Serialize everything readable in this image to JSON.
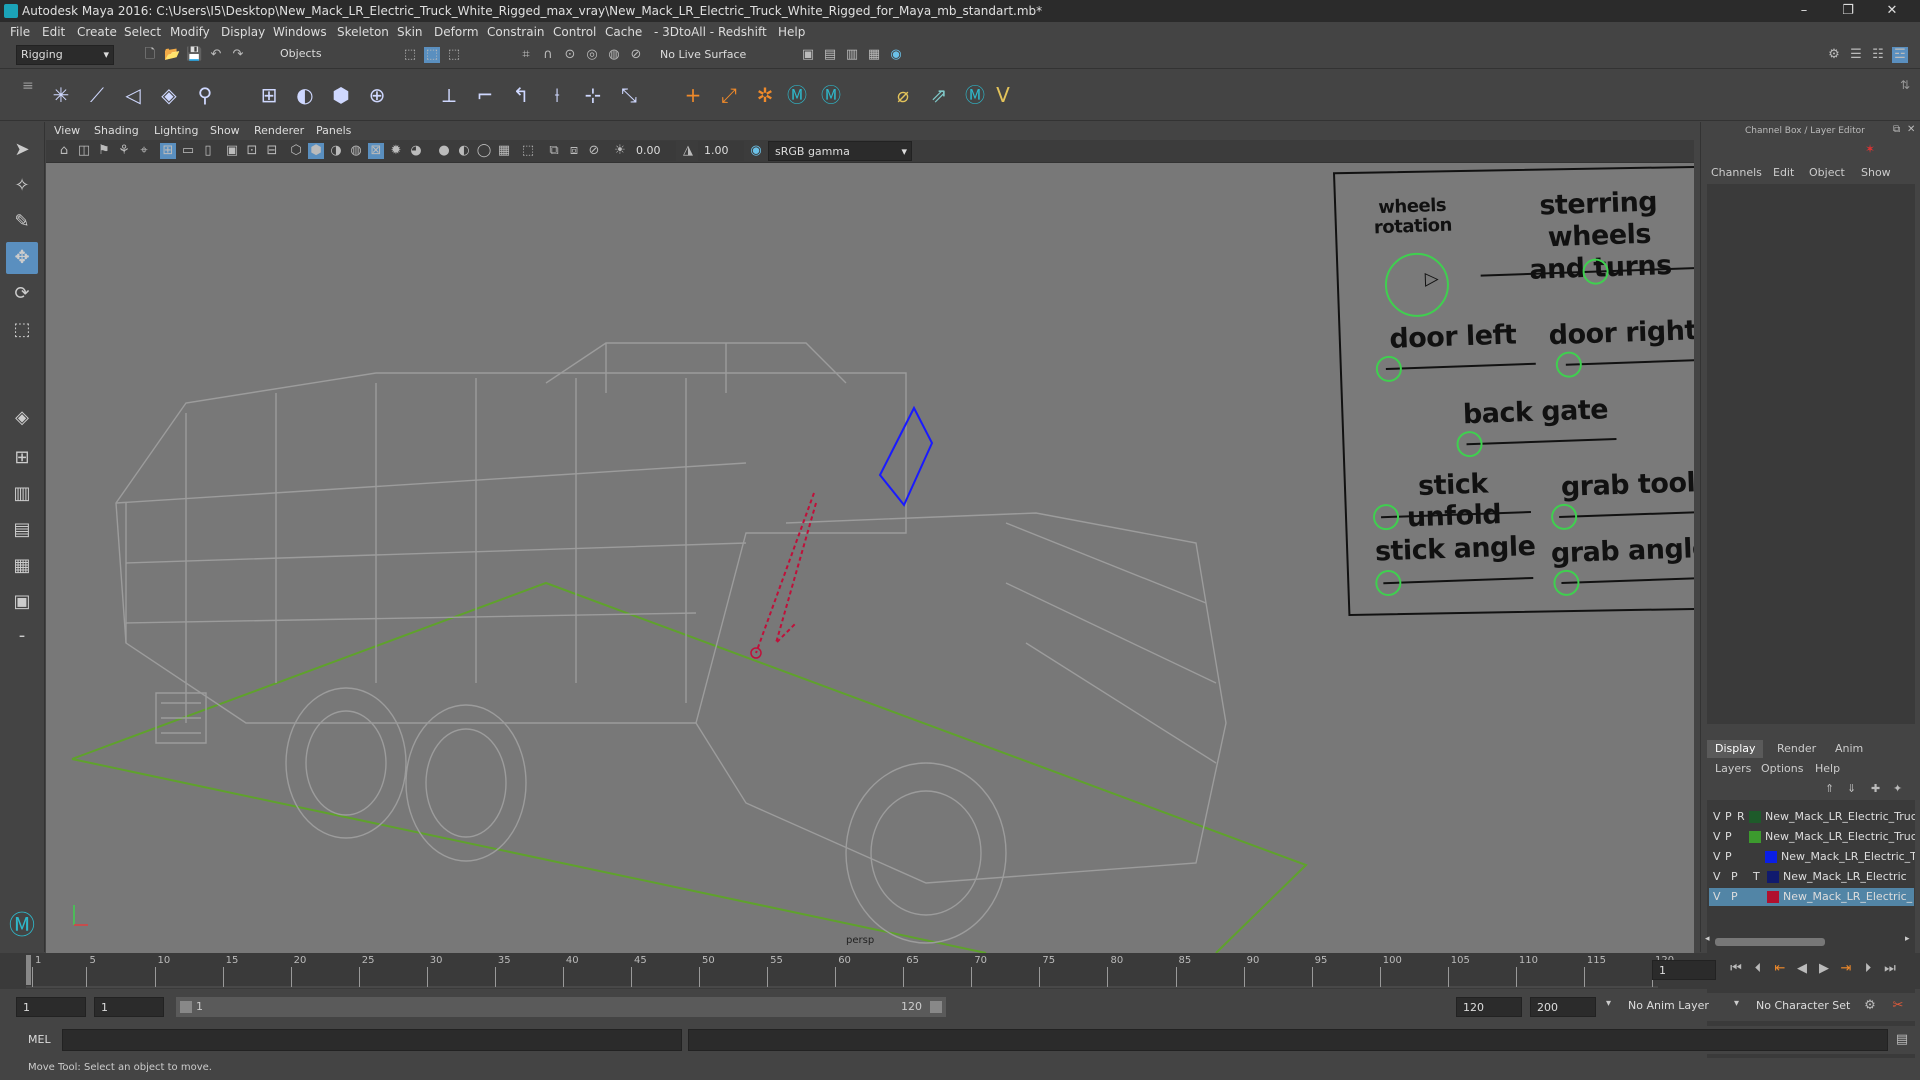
{
  "window": {
    "title": "Autodesk Maya 2016: C:\\Users\\I5\\Desktop\\New_Mack_LR_Electric_Truck_White_Rigged_max_vray\\New_Mack_LR_Electric_Truck_White_Rigged_for_Maya_mb_standart.mb*",
    "minimize": "–",
    "maximize": "❐",
    "close": "✕"
  },
  "menus": [
    "File",
    "Edit",
    "Create",
    "Select",
    "Modify",
    "Display",
    "Windows",
    "Skeleton",
    "Skin",
    "Deform",
    "Constrain",
    "Control",
    "Cache",
    "- 3DtoAll -",
    "Redshift",
    "Help"
  ],
  "status": {
    "mode": "Rigging",
    "select_mode": "Objects",
    "live_surface": "No Live Surface"
  },
  "panel_menus": [
    "View",
    "Shading",
    "Lighting",
    "Show",
    "Renderer",
    "Panels"
  ],
  "panel_toolbar": {
    "value_a": "0.00",
    "value_b": "1.00",
    "color_space": "sRGB gamma"
  },
  "viewport": {
    "camera_label": "persp"
  },
  "control_board": {
    "wheels_rotation": "wheels\nrotation",
    "steering": "sterring wheels\nand turns",
    "door_left": "door left",
    "door_right": "door right",
    "back_gate": "back gate",
    "stick_unfold": "stick unfold",
    "grab_tool": "grab tool",
    "stick_angle": "stick angle",
    "grab_angle": "grab angle"
  },
  "right_panel": {
    "header": "Channel Box / Layer Editor",
    "channel_tabs": [
      "Channels",
      "Edit",
      "Object",
      "Show"
    ],
    "layer_tabs": [
      "Display",
      "Render",
      "Anim"
    ],
    "layer_menus": [
      "Layers",
      "Options",
      "Help"
    ],
    "layers": [
      {
        "v": "V",
        "p": "P",
        "t": "R",
        "name": "New_Mack_LR_Electric_Truck",
        "color": "#1e5a2a",
        "selected": false
      },
      {
        "v": "V",
        "p": "P",
        "t": "",
        "name": "New_Mack_LR_Electric_Truck",
        "color": "#3c9a2e",
        "selected": false
      },
      {
        "v": "V",
        "p": "P",
        "t": "",
        "name": "New_Mack_LR_Electric_T",
        "color": "#0a1ee6",
        "selected": false
      },
      {
        "v": "V",
        "p": "P",
        "t": "T",
        "name": "New_Mack_LR_Electric",
        "color": "#101a6e",
        "selected": false
      },
      {
        "v": "V",
        "p": "P",
        "t": "",
        "name": "New_Mack_LR_Electric_",
        "color": "#b0102e",
        "selected": true
      }
    ]
  },
  "timeline": {
    "ticks": [
      "1",
      "5",
      "10",
      "15",
      "20",
      "25",
      "30",
      "35",
      "40",
      "45",
      "50",
      "55",
      "60",
      "65",
      "70",
      "75",
      "80",
      "85",
      "90",
      "95",
      "100",
      "105",
      "110",
      "115",
      "120"
    ],
    "current_frame": "1"
  },
  "range": {
    "start": "1",
    "playback_start": "1",
    "slider_start": "1",
    "slider_end": "120",
    "playback_end": "120",
    "end": "200",
    "anim_layer": "No Anim Layer",
    "character_set": "No Character Set"
  },
  "command": {
    "language": "MEL"
  },
  "help_line": "Move Tool: Select an object to move."
}
